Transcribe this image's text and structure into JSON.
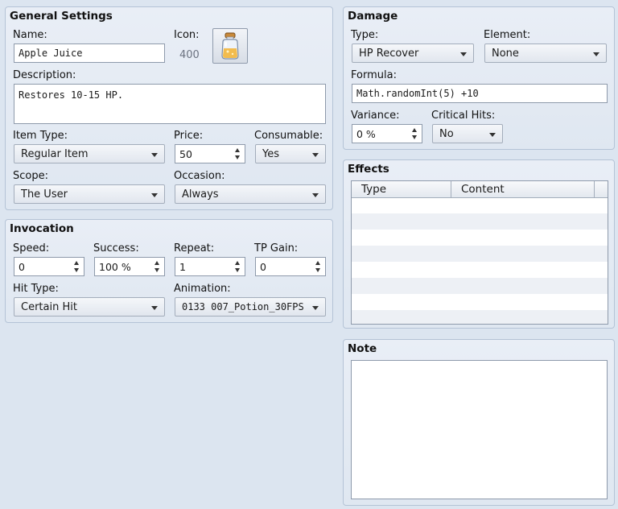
{
  "general": {
    "title": "General Settings",
    "name_label": "Name:",
    "name_value": "Apple Juice",
    "icon_label": "Icon:",
    "icon_index": "400",
    "icon_semantic": "potion-bottle-icon",
    "description_label": "Description:",
    "description_value": "Restores 10-15 HP.",
    "item_type_label": "Item Type:",
    "item_type_value": "Regular Item",
    "price_label": "Price:",
    "price_value": "50",
    "consumable_label": "Consumable:",
    "consumable_value": "Yes",
    "scope_label": "Scope:",
    "scope_value": "The User",
    "occasion_label": "Occasion:",
    "occasion_value": "Always"
  },
  "invocation": {
    "title": "Invocation",
    "speed_label": "Speed:",
    "speed_value": "0",
    "success_label": "Success:",
    "success_value": "100 %",
    "repeat_label": "Repeat:",
    "repeat_value": "1",
    "tp_gain_label": "TP Gain:",
    "tp_gain_value": "0",
    "hit_type_label": "Hit Type:",
    "hit_type_value": "Certain Hit",
    "animation_label": "Animation:",
    "animation_value": "0133 007_Potion_30FPS"
  },
  "damage": {
    "title": "Damage",
    "type_label": "Type:",
    "type_value": "HP Recover",
    "element_label": "Element:",
    "element_value": "None",
    "formula_label": "Formula:",
    "formula_value": "Math.randomInt(5) +10",
    "variance_label": "Variance:",
    "variance_value": "0 %",
    "critical_label": "Critical Hits:",
    "critical_value": "No"
  },
  "effects": {
    "title": "Effects",
    "columns": [
      "Type",
      "Content"
    ]
  },
  "note": {
    "title": "Note",
    "value": ""
  },
  "colors": {
    "background": "#dce5f0",
    "panel_border": "#b4c3d6",
    "alt_row": "#edf0f5"
  }
}
